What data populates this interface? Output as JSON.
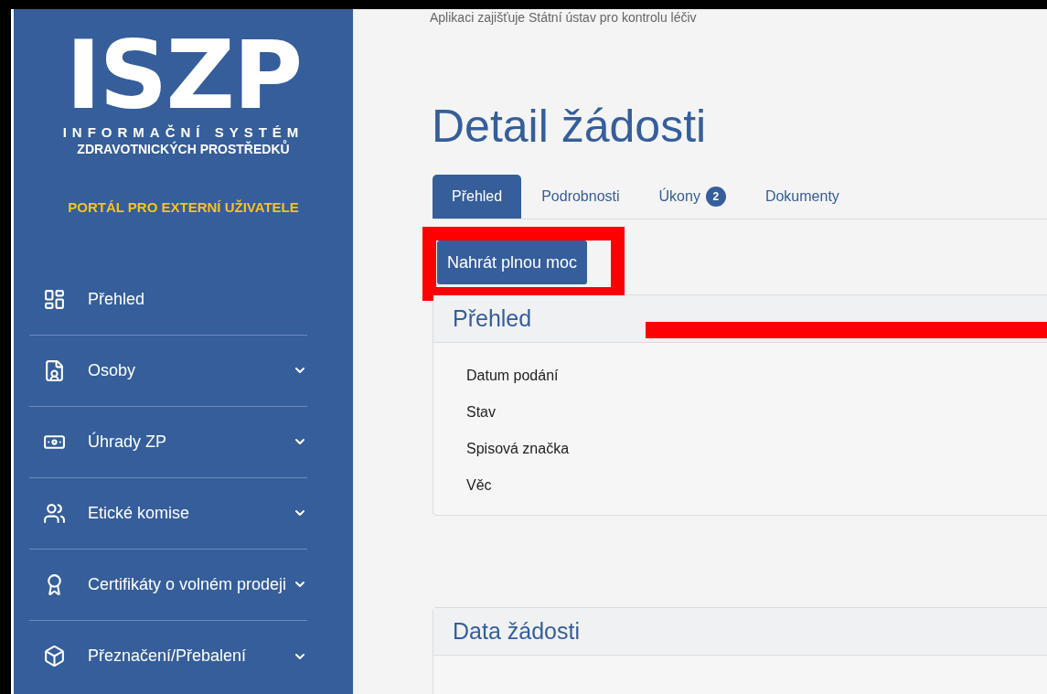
{
  "sidebar": {
    "logo": "ISZP",
    "subtitle_1": "INFORMAČNÍ SYSTÉM",
    "subtitle_2": "ZDRAVOTNICKÝCH PROSTŘEDKŮ",
    "portal": "PORTÁL PRO EXTERNÍ UŽIVATELE",
    "items": [
      {
        "label": "Přehled",
        "kind": "dashboard",
        "expandable": false
      },
      {
        "label": "Osoby",
        "kind": "person",
        "expandable": true
      },
      {
        "label": "Úhrady ZP",
        "kind": "money",
        "expandable": true
      },
      {
        "label": "Etické komise",
        "kind": "users",
        "expandable": true
      },
      {
        "label": "Certifikáty o volném prodeji",
        "kind": "award",
        "expandable": true
      },
      {
        "label": "Přeznačení/Přebalení",
        "kind": "box",
        "expandable": true
      }
    ]
  },
  "header_note": "Aplikaci zajišťuje Státní ústav pro kontrolu léčiv",
  "page_title": "Detail žádosti",
  "tabs": [
    {
      "label": "Přehled",
      "selected": true
    },
    {
      "label": "Podrobnosti",
      "selected": false
    },
    {
      "label": "Úkony",
      "badge": "2",
      "selected": false
    },
    {
      "label": "Dokumenty",
      "selected": false
    }
  ],
  "action_button": "Nahrát plnou moc",
  "overview": {
    "title": "Přehled",
    "fields": [
      "Datum podání",
      "Stav",
      "Spisová značka",
      "Věc"
    ]
  },
  "data_section": {
    "title": "Data žádosti"
  }
}
